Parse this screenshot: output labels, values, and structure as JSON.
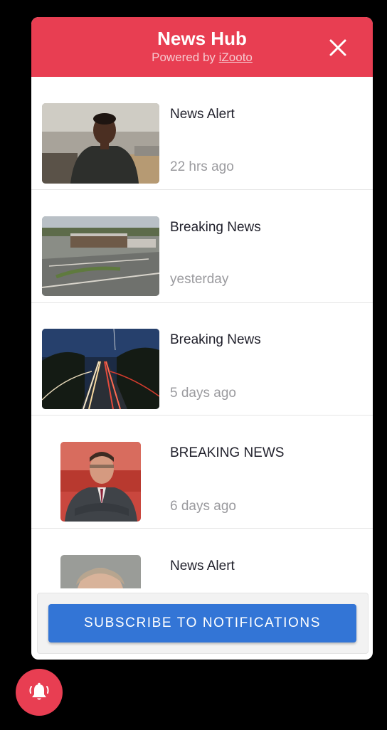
{
  "header": {
    "title": "News Hub",
    "powered_prefix": "Powered by ",
    "powered_link": "iZooto",
    "close_icon": "close-icon",
    "color": "#e83e52"
  },
  "items": [
    {
      "title": "News Alert",
      "time": "22 hrs ago",
      "image": "man-portrait-photo"
    },
    {
      "title": "Breaking News",
      "time": "yesterday",
      "image": "airport-aerial-photo"
    },
    {
      "title": "Breaking News",
      "time": "5 days ago",
      "image": "highway-night-photo"
    },
    {
      "title": "BREAKING NEWS",
      "time": "6 days ago",
      "image": "businessman-photo"
    },
    {
      "title": "News Alert",
      "time": "",
      "image": "man-headshot-photo"
    }
  ],
  "footer": {
    "subscribe_label": "SUBSCRIBE TO NOTIFICATIONS",
    "button_color": "#3375d6"
  },
  "fab": {
    "icon": "bell-icon",
    "color": "#e83e52"
  }
}
